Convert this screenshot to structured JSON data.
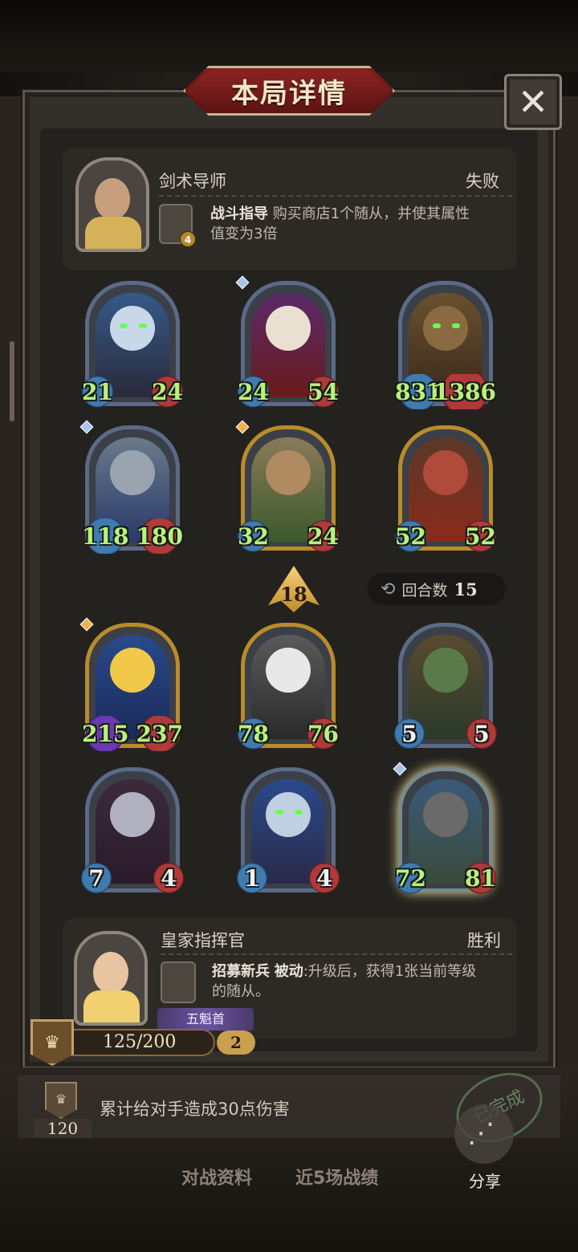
{
  "title": "本局详情",
  "close_icon": "✕",
  "opponent": {
    "name": "剑术导师",
    "result": "失败",
    "skill_level": "4",
    "skill_name": "战斗指导",
    "skill_desc_line1": " 购买商店1个随从，并使其属性",
    "skill_desc_line2": "值变为3倍"
  },
  "opponent_cards": [
    {
      "atk": "21",
      "hp": "24"
    },
    {
      "atk": "24",
      "hp": "54"
    },
    {
      "atk": "831",
      "hp": "1386"
    },
    {
      "atk": "118",
      "hp": "180"
    },
    {
      "atk": "32",
      "hp": "24"
    },
    {
      "atk": "52",
      "hp": "52"
    }
  ],
  "level_badge": "18",
  "round": {
    "label": "回合数",
    "value": "15"
  },
  "player_cards": [
    {
      "atk": "215",
      "hp": "237"
    },
    {
      "atk": "78",
      "hp": "76"
    },
    {
      "atk": "5",
      "hp": "5"
    },
    {
      "atk": "7",
      "hp": "4"
    },
    {
      "atk": "1",
      "hp": "4"
    },
    {
      "atk": "72",
      "hp": "81"
    }
  ],
  "player": {
    "name": "皇家指挥官",
    "result": "胜利",
    "skill_name": "招募新兵",
    "skill_type": "被动",
    "skill_desc_line1": ":升级后，获得1张当前等级",
    "skill_desc_line2": "的随从。",
    "title_tag": "五魁首"
  },
  "rank": {
    "progress": "125/200",
    "level": "2",
    "crest_icon": "crown-icon"
  },
  "quest": {
    "points": "120",
    "text": "累计给对手造成30点伤害",
    "stamp": "已完成"
  },
  "share": {
    "label": "分享",
    "icon": "share-icon"
  },
  "tabs": [
    "对战资料",
    "近5场战绩"
  ],
  "colors": {
    "title_red": "#7a1e1e",
    "attack_blue": "#3f7bb0",
    "health_red": "#b03a3a",
    "stat_green": "#b8f27a"
  }
}
